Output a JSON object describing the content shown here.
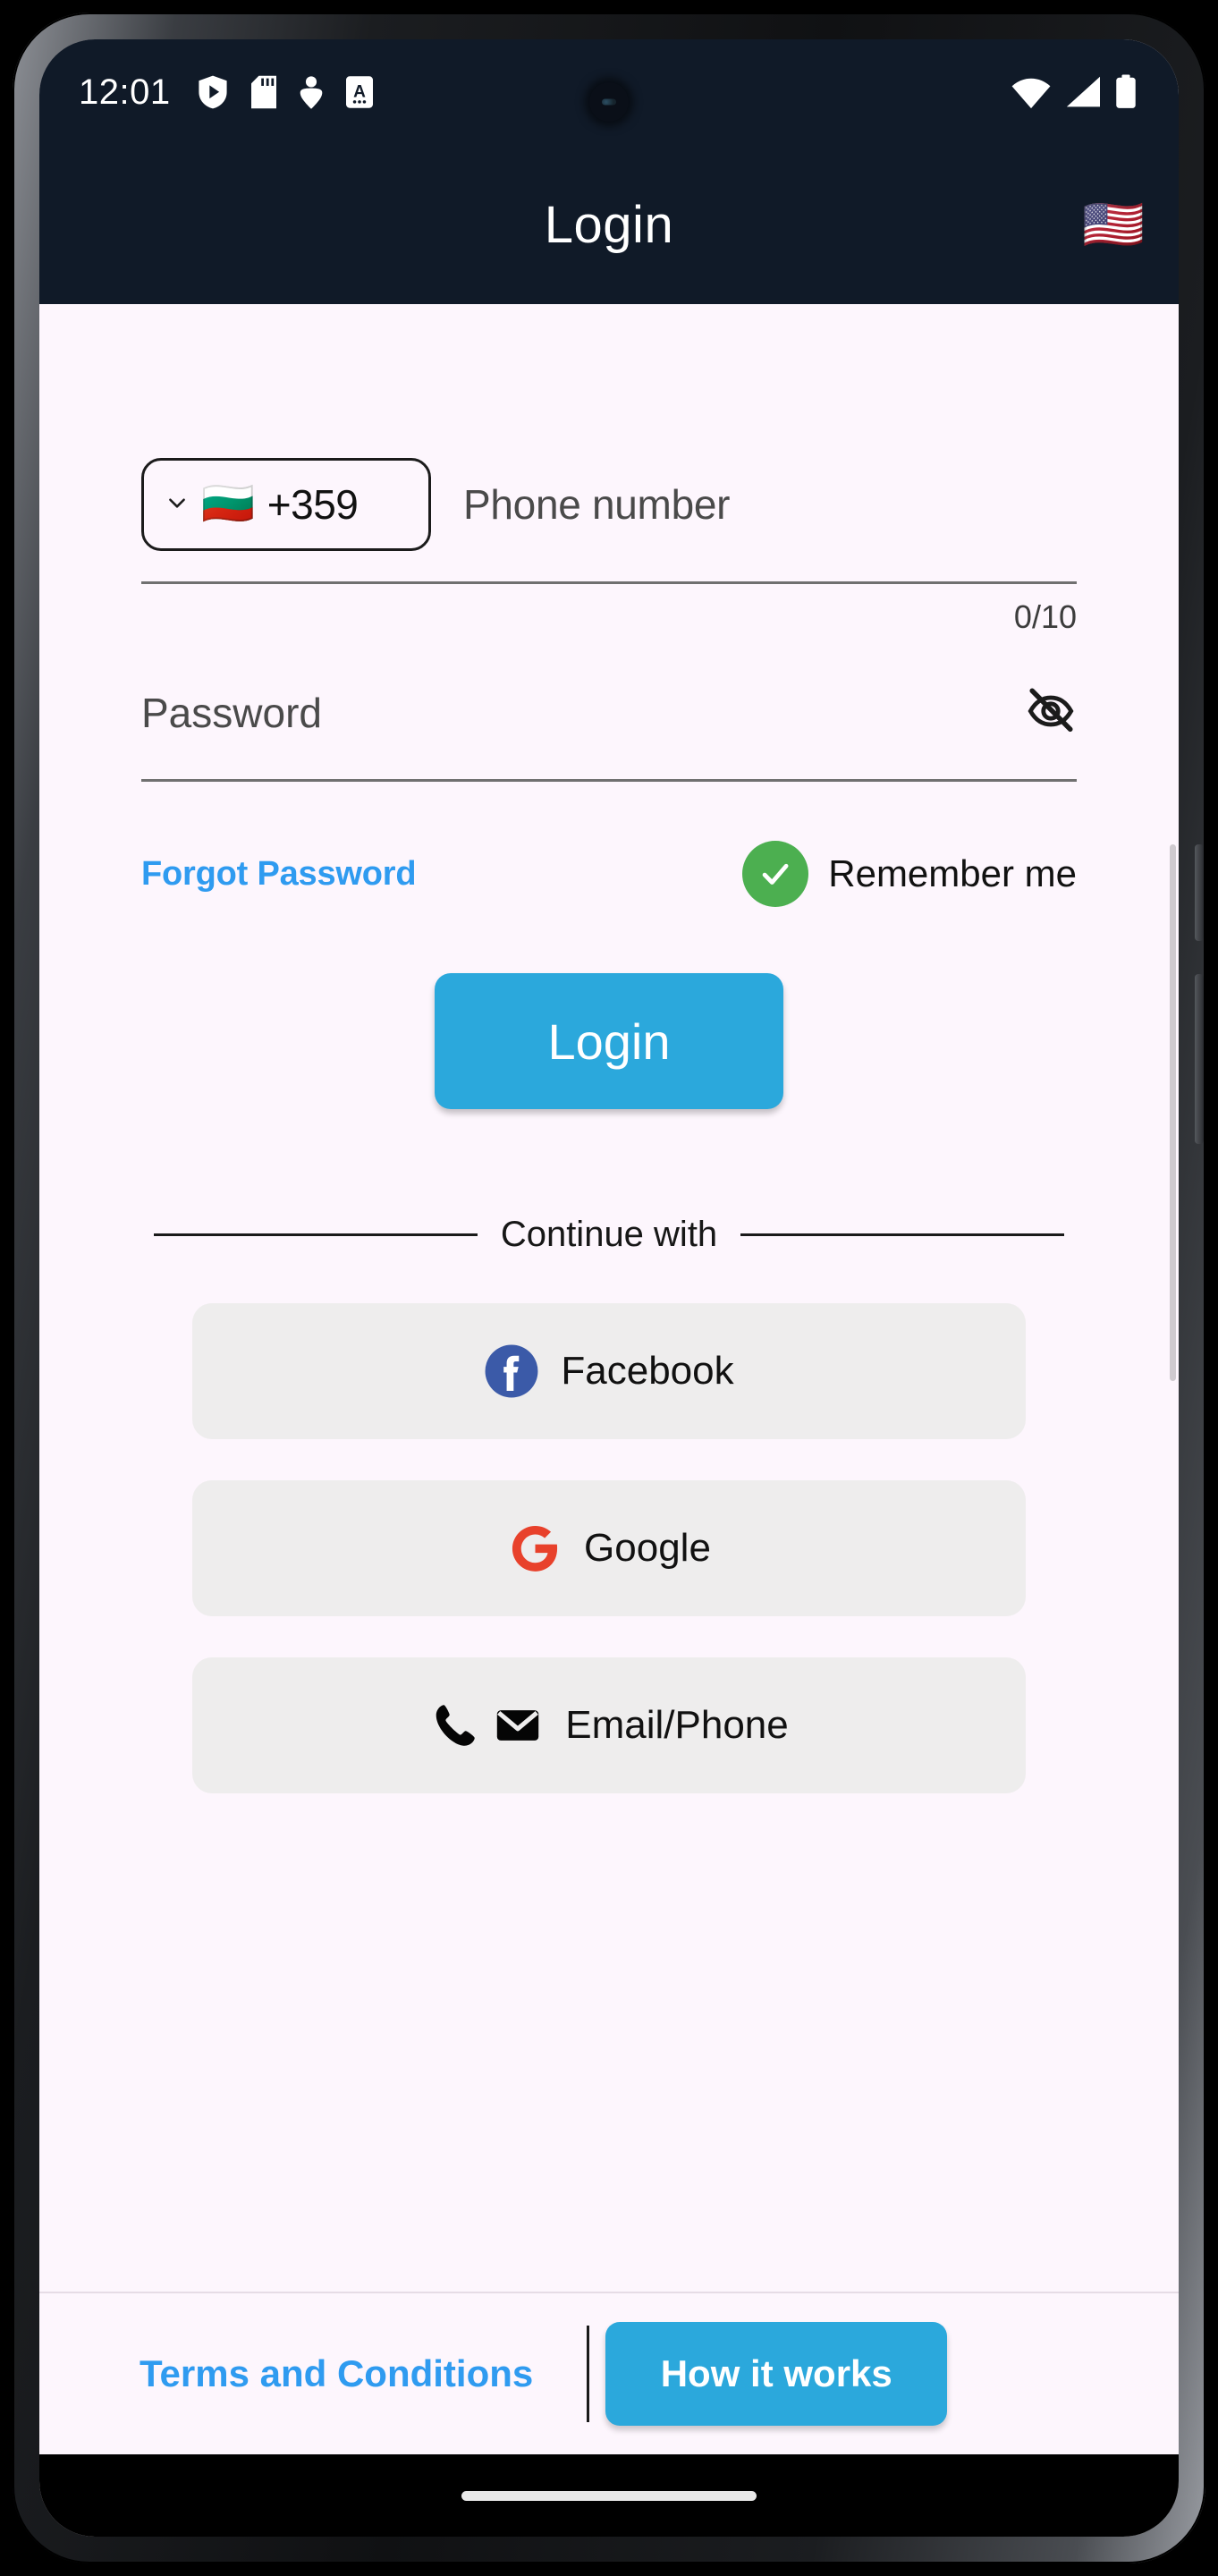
{
  "status_bar": {
    "time": "12:01",
    "left_icons": [
      "shield-play-icon",
      "sd-card-icon",
      "person-pin-icon",
      "letter-a-icon"
    ],
    "right_icons": [
      "wifi-icon",
      "cellular-signal-icon",
      "battery-icon"
    ]
  },
  "app_bar": {
    "title": "Login",
    "language_flag": "🇺🇸"
  },
  "form": {
    "country_code": "+359",
    "country_flag": "🇧🇬",
    "phone_placeholder": "Phone number",
    "phone_value": "",
    "char_counter": "0/10",
    "password_placeholder": "Password",
    "password_value": "",
    "forgot_password": "Forgot Password",
    "remember_me": "Remember me",
    "remember_me_checked": true,
    "login_button": "Login"
  },
  "continue": {
    "divider_label": "Continue with",
    "options": [
      {
        "label": "Facebook",
        "icon": "facebook-icon",
        "color": "#3b5aa8"
      },
      {
        "label": "Google",
        "icon": "google-icon",
        "color": "#e8412b"
      },
      {
        "label": "Email/Phone",
        "icon": "phone-envelope-icon",
        "color": "#050505"
      }
    ]
  },
  "footer": {
    "terms_link": "Terms and Conditions",
    "how_it_works_button": "How it works"
  },
  "colors": {
    "app_bar": "#101a28",
    "background": "#fdf6fd",
    "accent": "#2ba8dc",
    "link": "#2f9bf0",
    "check_green": "#4caf50",
    "social_bg": "#eeeded"
  }
}
